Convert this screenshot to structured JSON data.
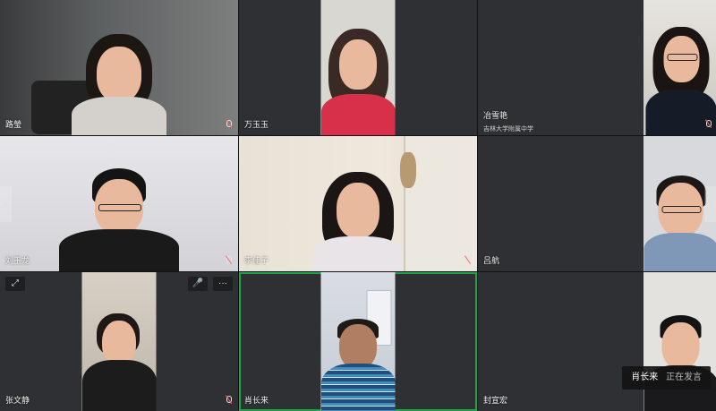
{
  "navigation": {
    "prev_label": "‹",
    "next_label": "›"
  },
  "participants": [
    {
      "name": "路瑩"
    },
    {
      "name": "万玉玉"
    },
    {
      "name": "冶雪艳",
      "org": "吉林大学附属中学"
    },
    {
      "name": "刘玉龙"
    },
    {
      "name": "李佳子"
    },
    {
      "name": "吕航"
    },
    {
      "name": "张文静"
    },
    {
      "name": "肖长来",
      "speaking": true
    },
    {
      "name": "封宣宏"
    }
  ],
  "tile_controls": {
    "expand_icon": "⤢",
    "mic_icon": "🎤",
    "more_label": "···"
  },
  "speaking_toast": {
    "name": "肖长来",
    "status": "正在发言"
  },
  "colors": {
    "speaking_border": "#1fa34a",
    "tile_bg": "#2f3033"
  }
}
